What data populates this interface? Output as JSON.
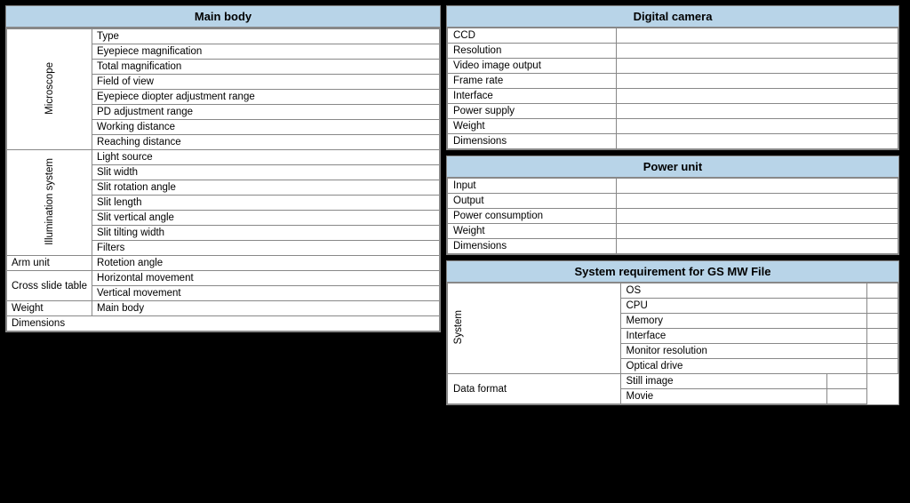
{
  "left": {
    "header": "Main body",
    "microscope_label": "Microscope",
    "illumination_label": "Illumination system",
    "microscope_rows": [
      "Type",
      "Eyepiece magnification",
      "Total magnification",
      "Field of view",
      "Eyepiece diopter adjustment range",
      "PD adjustment range",
      "Working distance",
      "Reaching distance"
    ],
    "illumination_rows": [
      "Light source",
      "Slit width",
      "Slit rotation angle",
      "Slit length",
      "Slit vertical angle",
      "Slit tilting width",
      "Filters"
    ],
    "arm_unit_label": "Arm unit",
    "arm_unit_row": "Rotetion angle",
    "cross_slide_label": "Cross slide table",
    "cross_slide_rows": [
      "Horizontal movement",
      "Vertical movement"
    ],
    "weight_label": "Weight",
    "weight_row": "Main body",
    "dimensions_label": "Dimensions"
  },
  "right": {
    "digital_camera_header": "Digital camera",
    "digital_camera_rows": [
      "CCD",
      "Resolution",
      "Video image output",
      "Frame rate",
      "Interface",
      "Power supply",
      "Weight",
      "Dimensions"
    ],
    "power_unit_header": "Power unit",
    "power_unit_rows": [
      "Input",
      "Output",
      "Power consumption",
      "Weight",
      "Dimensions"
    ],
    "sysreq_header": "System requirement for GS MW File",
    "system_label": "System",
    "system_rows": [
      "OS",
      "CPU",
      "Memory",
      "Interface",
      "Monitor resolution",
      "Optical drive"
    ],
    "data_format_label": "Data format",
    "data_format_rows": [
      "Still image",
      "Movie"
    ]
  }
}
